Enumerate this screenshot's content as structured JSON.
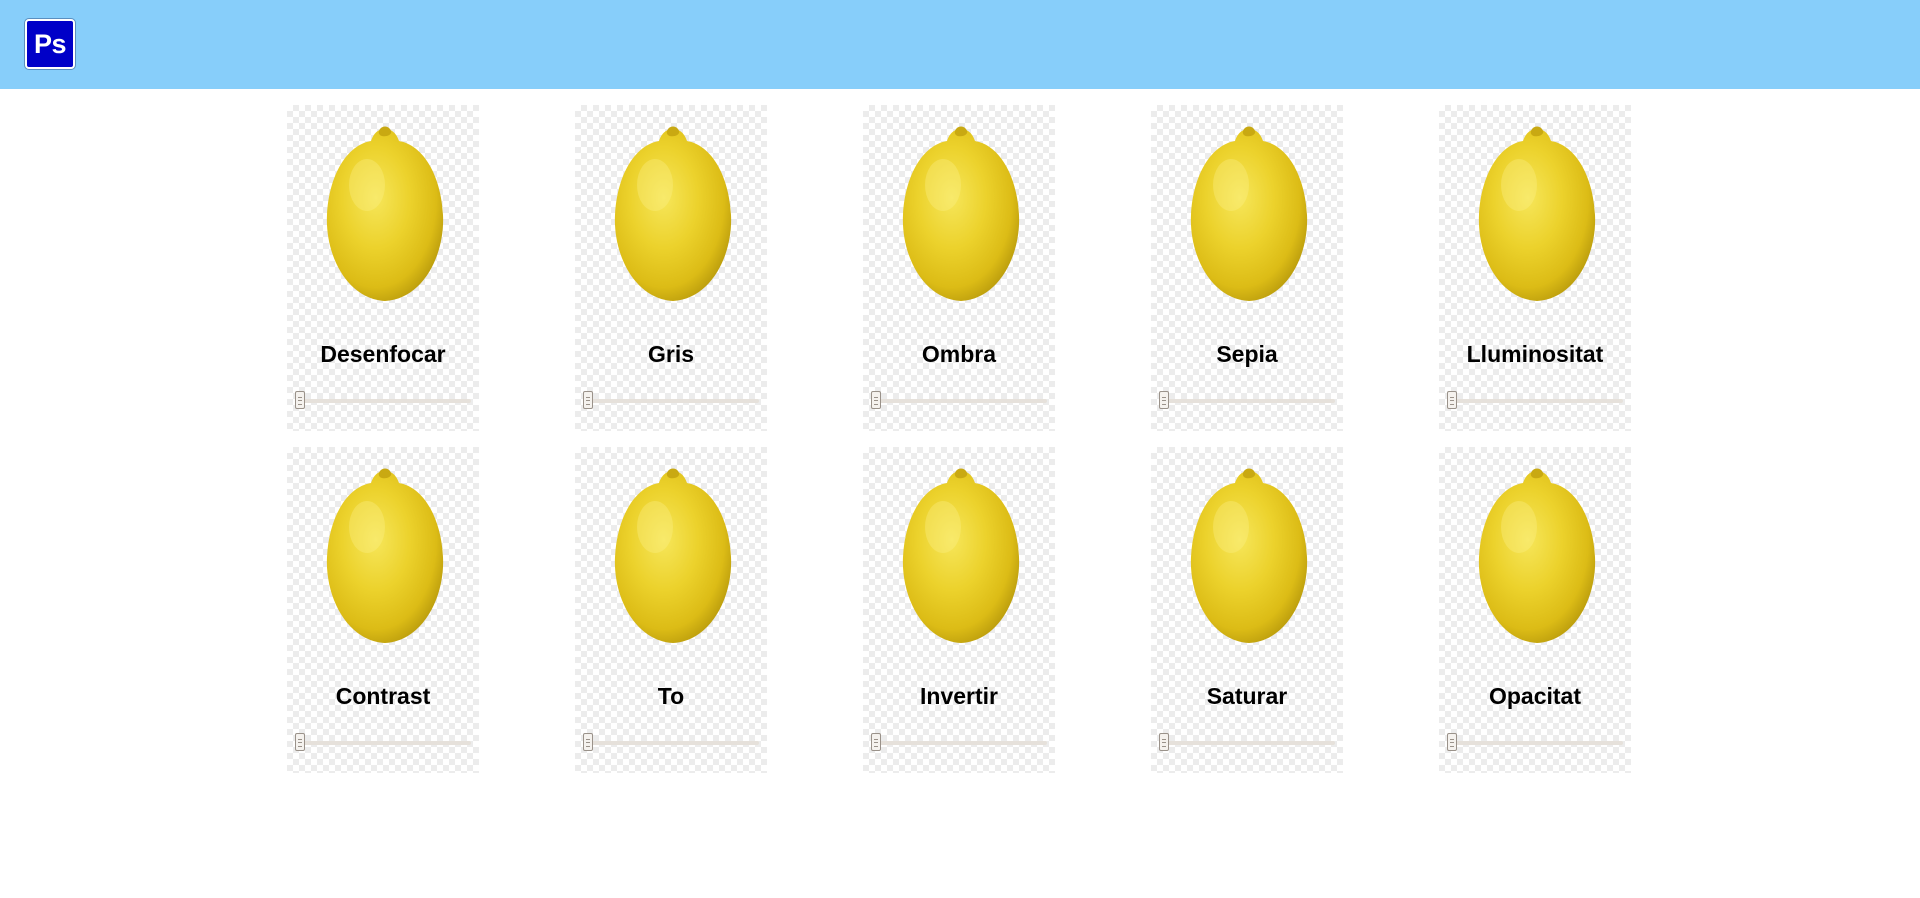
{
  "header": {
    "logo_text": "Ps",
    "background_color": "#87cefa",
    "logo_color": "#0000c8"
  },
  "filters": [
    {
      "label": "Desenfocar",
      "slider_value": 0
    },
    {
      "label": "Gris",
      "slider_value": 0
    },
    {
      "label": "Ombra",
      "slider_value": 0
    },
    {
      "label": "Sepia",
      "slider_value": 0
    },
    {
      "label": "Lluminositat",
      "slider_value": 0
    },
    {
      "label": "Contrast",
      "slider_value": 0
    },
    {
      "label": "To",
      "slider_value": 0
    },
    {
      "label": "Invertir",
      "slider_value": 0
    },
    {
      "label": "Saturar",
      "slider_value": 0
    },
    {
      "label": "Opacitat",
      "slider_value": 0
    }
  ],
  "image": {
    "subject": "lemon"
  }
}
